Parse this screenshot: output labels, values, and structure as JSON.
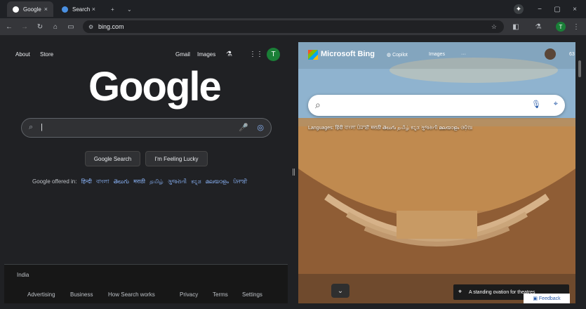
{
  "browser": {
    "tabs": [
      {
        "label": "Google",
        "close": "×"
      },
      {
        "label": "Search",
        "close": "×"
      }
    ],
    "new_tab": "+",
    "url": "bing.com",
    "profile_initial": "T"
  },
  "google": {
    "top_links": [
      "About",
      "Store",
      "Gmail",
      "Images"
    ],
    "logo_text": "Google",
    "search_placeholder": "",
    "buttons": [
      "Google Search",
      "I'm Feeling Lucky"
    ],
    "offered_in": "Google offered in:",
    "languages": [
      "हिन्दी",
      "বাংলা",
      "తెలుగు",
      "मराठी",
      "தமிழ்",
      "ગુજરાતી",
      "ಕನ್ನಡ",
      "മലയാളം",
      "ਪੰਜਾਬੀ"
    ],
    "country": "India",
    "footer_links": [
      "Advertising",
      "Business",
      "How Search works",
      "Privacy",
      "Terms",
      "Settings"
    ],
    "profile_initial": "T"
  },
  "bing": {
    "title": "Microsoft Bing",
    "tabs": [
      "Copilot",
      "Images",
      "···"
    ],
    "rewards": "63",
    "languages_label": "Languages:",
    "languages": [
      "हिंदी",
      "বাংলা",
      "ਪੰਜਾਬੀ",
      "मराठी",
      "తెలుగు",
      "தமிழ்",
      "ಕನ್ನಡ",
      "ગુજરાતી",
      "മലയാളം",
      "ଓଡ଼ିଆ"
    ],
    "caption": "A standing ovation for theatres",
    "feedback": "Feedback",
    "expander": "⌄"
  },
  "colors": {
    "google_bg": "#202124",
    "link_blue": "#8ab4f8",
    "bing_accent": "#2a5caa"
  }
}
